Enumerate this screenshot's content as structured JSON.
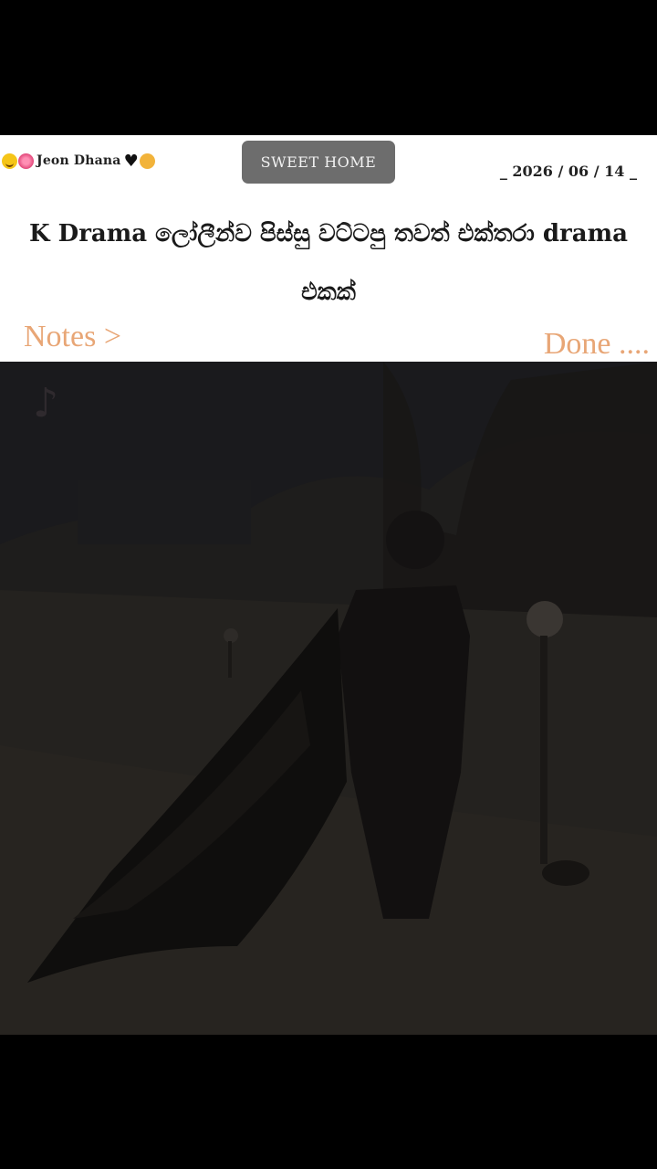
{
  "header": {
    "author_name": "Jeon Dhana",
    "author_emojis_left": [
      "smiling-face",
      "flower"
    ],
    "author_emojis_right": [
      "black-heart",
      "cat-face"
    ],
    "sweet_home_label": "SWEET HOME",
    "date": "_ 2026 / 06 / 14 _"
  },
  "post": {
    "headline": "K Drama ලෝලීන්ව පිස්සු වට්ටපු තවත් එක්තරා drama එකක්",
    "notes_label": "Notes >",
    "done_label": "Done ...."
  },
  "video": {
    "watermark_icon": "tiktok-logo-icon"
  },
  "colors": {
    "background": "#000000",
    "card": "#ffffff",
    "button": "#6d6d6d",
    "accent_text": "#e8a676"
  }
}
